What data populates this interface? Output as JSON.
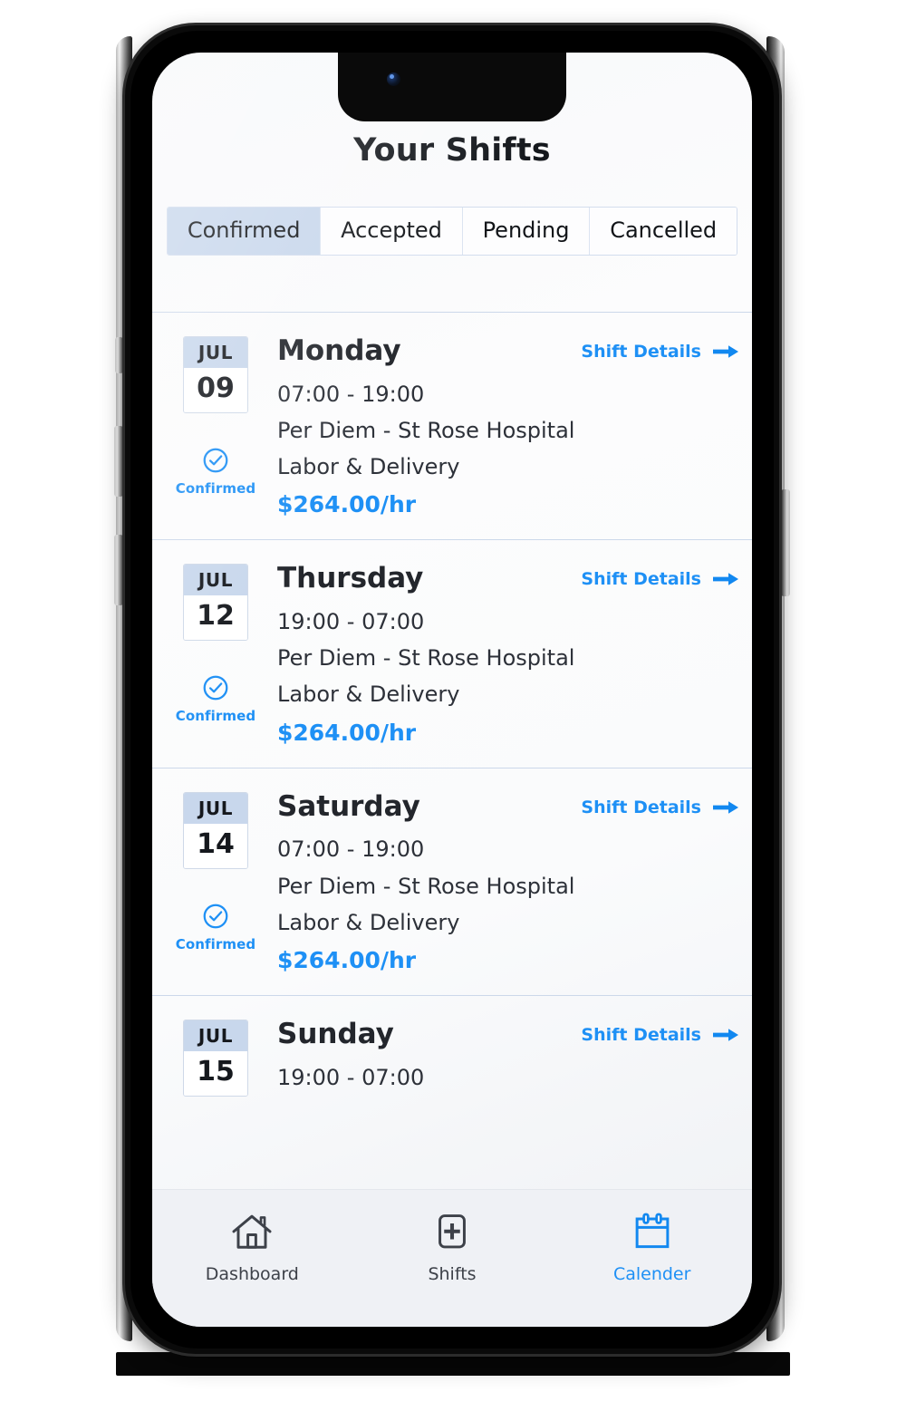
{
  "header": {
    "title": "Your Shifts"
  },
  "tabs": [
    {
      "label": "Confirmed",
      "active": true
    },
    {
      "label": "Accepted",
      "active": false
    },
    {
      "label": "Pending",
      "active": false
    },
    {
      "label": "Cancelled",
      "active": false
    }
  ],
  "details_link": {
    "label": "Shift Details",
    "icon": "arrow-right-icon"
  },
  "colors": {
    "accent_blue": "#1e90f5",
    "tab_active_bg": "#c8d7ec",
    "divider": "#ccd8ea",
    "title_dark": "#15181d",
    "nav_bg": "#eff1f5"
  },
  "shifts": [
    {
      "month": "JUL",
      "day": "09",
      "day_name": "Monday",
      "time": "07:00 - 19:00",
      "facility": "Per Diem - St Rose Hospital",
      "unit": "Labor & Delivery",
      "rate": "$264.00/hr",
      "status": "Confirmed",
      "status_icon": "check-circle-icon",
      "details_label": "Shift Details"
    },
    {
      "month": "JUL",
      "day": "12",
      "day_name": "Thursday",
      "time": "19:00 - 07:00",
      "facility": "Per Diem - St Rose Hospital",
      "unit": "Labor & Delivery",
      "rate": "$264.00/hr",
      "status": "Confirmed",
      "status_icon": "check-circle-icon",
      "details_label": "Shift Details"
    },
    {
      "month": "JUL",
      "day": "14",
      "day_name": "Saturday",
      "time": "07:00 - 19:00",
      "facility": "Per Diem - St Rose Hospital",
      "unit": "Labor & Delivery",
      "rate": "$264.00/hr",
      "status": "Confirmed",
      "status_icon": "check-circle-icon",
      "details_label": "Shift Details"
    },
    {
      "month": "JUL",
      "day": "15",
      "day_name": "Sunday",
      "time": "19:00 - 07:00",
      "facility": "",
      "unit": "",
      "rate": "",
      "status": "",
      "status_icon": "check-circle-icon",
      "details_label": "Shift Details"
    }
  ],
  "bottom_nav": [
    {
      "label": "Dashboard",
      "icon": "home-icon",
      "active": false
    },
    {
      "label": "Shifts",
      "icon": "plus-box-icon",
      "active": false
    },
    {
      "label": "Calender",
      "icon": "calendar-icon",
      "active": true
    }
  ]
}
